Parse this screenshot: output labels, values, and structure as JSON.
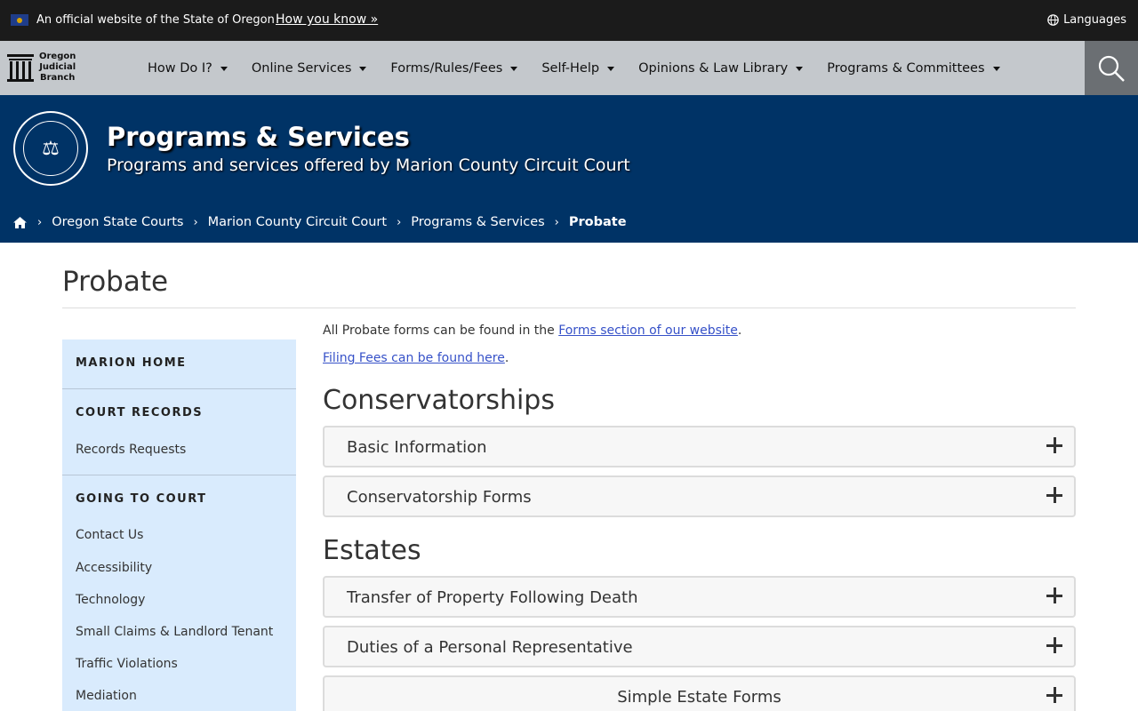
{
  "topbar": {
    "official_text": "An official website of the State of Oregon",
    "how_you_know": "How you know »",
    "languages": "Languages"
  },
  "logo": {
    "line1": "Oregon",
    "line2": "Judicial",
    "line3": "Branch"
  },
  "nav": {
    "items": [
      {
        "label": "How Do I?"
      },
      {
        "label": "Online Services"
      },
      {
        "label": "Forms/Rules/Fees"
      },
      {
        "label": "Self-Help"
      },
      {
        "label": "Opinions & Law Library"
      },
      {
        "label": "Programs & Committees"
      }
    ]
  },
  "hero": {
    "title": "Programs & Services",
    "subtitle": "Programs and services offered by Marion County Circuit Court"
  },
  "breadcrumb": {
    "items": [
      "Oregon State Courts",
      "Marion County Circuit Court",
      "Programs & Services"
    ],
    "current": "Probate"
  },
  "page": {
    "title": "Probate"
  },
  "sidebar": {
    "home": "MARION HOME",
    "court_records": "COURT RECORDS",
    "records_links": [
      "Records Requests"
    ],
    "going_to_court": "GOING TO COURT",
    "court_links": [
      "Contact Us",
      "Accessibility",
      "Technology",
      "Small Claims & Landlord Tenant",
      "Traffic Violations",
      "Mediation"
    ]
  },
  "main": {
    "forms_prefix": "All Probate forms can be found in the ",
    "forms_link": "Forms section of our website",
    "forms_suffix": ".",
    "fees_link": "Filing Fees can be found here",
    "fees_suffix": ".",
    "conservatorships": {
      "heading": "Conservatorships",
      "items": [
        "Basic Information",
        "Conservatorship Forms"
      ]
    },
    "estates": {
      "heading": "Estates",
      "items": [
        "Transfer of Property Following Death",
        "Duties of a Personal Representative",
        "Simple Estate Forms"
      ]
    }
  },
  "colors": {
    "topbar_bg": "#1b1b1b",
    "nav_bg": "#c4c8cc",
    "search_bg": "#6b6f73",
    "hero_bg": "#003366",
    "sidebar_bg": "#d9ebfd",
    "link": "#3651c8"
  }
}
